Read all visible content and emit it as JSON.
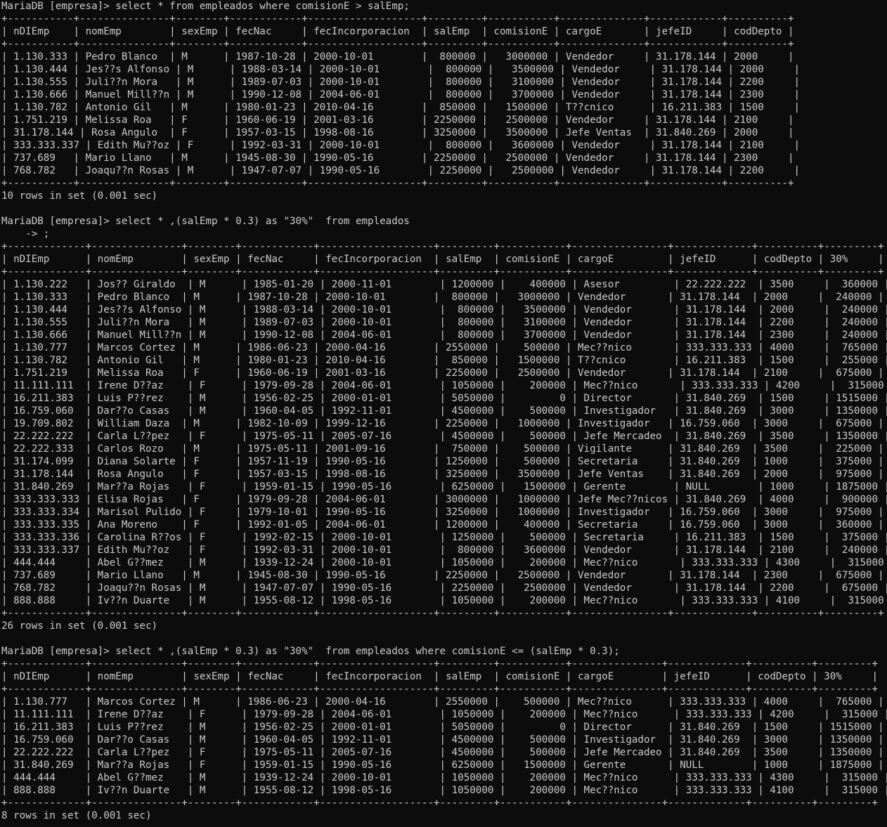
{
  "terminal": {
    "lines": [
      "MariaDB [empresa]> select * from empleados where comisionE > salEmp;",
      "+-----------+---------------+--------+------------+-------------------+---------+-----------+--------------+------------+----------+",
      "| nDIEmp    | nomEmp        | sexEmp | fecNac     | fecIncorporacion  | salEmp  | comisionE | cargoE       | jefeID     | codDepto |",
      "+-----------+---------------+--------+------------+-------------------+---------+-----------+--------------+------------+----------+",
      "| 1.130.333 | Pedro Blanco  | M      | 1987-10-28 | 2000-10-01        |  800000 |   3000000 | Vendedor     | 31.178.144 | 2000     |",
      "| 1.130.444 | Jes??s Alfonso | M      | 1988-03-14 | 2000-10-01        |  800000 |   3500000 | Vendedor     | 31.178.144 | 2000     |",
      "| 1.130.555 | Juli??n Mora   | M      | 1989-07-03 | 2000-10-01        |  800000 |   3100000 | Vendedor     | 31.178.144 | 2200     |",
      "| 1.130.666 | Manuel Mill??n | M      | 1990-12-08 | 2004-06-01        |  800000 |   3700000 | Vendedor     | 31.178.144 | 2300     |",
      "| 1.130.782 | Antonio Gil   | M      | 1980-01-23 | 2010-04-16        |  850000 |   1500000 | T??cnico      | 16.211.383 | 1500     |",
      "| 1.751.219 | Melissa Roa   | F      | 1960-06-19 | 2001-03-16        | 2250000 |   2500000 | Vendedor     | 31.178.144 | 2100     |",
      "| 31.178.144 | Rosa Angulo  | F      | 1957-03-15 | 1998-08-16        | 3250000 |   3500000 | Jefe Ventas  | 31.840.269 | 2000     |",
      "| 333.333.337 | Edith Mu??oz | F      | 1992-03-31 | 2000-10-01        |  800000 |   3600000 | Vendedor     | 31.178.144 | 2100     |",
      "| 737.689   | Mario Llano   | M      | 1945-08-30 | 1990-05-16        | 2250000 |   2500000 | Vendedor     | 31.178.144 | 2300     |",
      "| 768.782   | Joaqu??n Rosas | M      | 1947-07-07 | 1990-05-16        | 2250000 |   2500000 | Vendedor     | 31.178.144 | 2200     |",
      "+-----------+---------------+--------+------------+-------------------+---------+-----------+--------------+------------+----------+",
      "10 rows in set (0.001 sec)",
      "",
      "MariaDB [empresa]> select * ,(salEmp * 0.3) as \"30%\"  from empleados",
      "    -> ;",
      "+-------------+---------------+--------+------------+-------------------+---------+-----------+----------------+-------------+----------+---------+",
      "| nDIEmp      | nomEmp        | sexEmp | fecNac     | fecIncorporacion  | salEmp  | comisionE | cargoE         | jefeID      | codDepto | 30%     |",
      "+-------------+---------------+--------+------------+-------------------+---------+-----------+----------------+-------------+----------+---------+",
      "| 1.130.222   | Jos?? Giraldo  | M      | 1985-01-20 | 2000-11-01        | 1200000 |    400000 | Asesor         | 22.222.222  | 3500     |  360000 |",
      "| 1.130.333   | Pedro Blanco  | M      | 1987-10-28 | 2000-10-01        |  800000 |   3000000 | Vendedor       | 31.178.144  | 2000     |  240000 |",
      "| 1.130.444   | Jes??s Alfonso | M      | 1988-03-14 | 2000-10-01        |  800000 |   3500000 | Vendedor       | 31.178.144  | 2000     |  240000 |",
      "| 1.130.555   | Juli??n Mora   | M      | 1989-07-03 | 2000-10-01        |  800000 |   3100000 | Vendedor       | 31.178.144  | 2200     |  240000 |",
      "| 1.130.666   | Manuel Mill??n | M      | 1990-12-08 | 2004-06-01        |  800000 |   3700000 | Vendedor       | 31.178.144  | 2300     |  240000 |",
      "| 1.130.777   | Marcos Cortez | M      | 1986-06-23 | 2000-04-16        | 2550000 |    500000 | Mec??nico       | 333.333.333 | 4000     |  765000 |",
      "| 1.130.782   | Antonio Gil   | M      | 1980-01-23 | 2010-04-16        |  850000 |   1500000 | T??cnico        | 16.211.383  | 1500     |  255000 |",
      "| 1.751.219   | Melissa Roa   | F      | 1960-06-19 | 2001-03-16        | 2250000 |   2500000 | Vendedor       | 31.178.144  | 2100     |  675000 |",
      "| 11.111.111  | Irene D??az    | F      | 1979-09-28 | 2004-06-01        | 1050000 |    200000 | Mec??nico       | 333.333.333 | 4200     |  315000 |",
      "| 16.211.383  | Luis P??rez    | M      | 1956-02-25 | 2000-01-01        | 5050000 |         0 | Director       | 31.840.269  | 1500     | 1515000 |",
      "| 16.759.060  | Dar??o Casas   | M      | 1960-04-05 | 1992-11-01        | 4500000 |    500000 | Investigador   | 31.840.269  | 3000     | 1350000 |",
      "| 19.709.802  | William Daza  | M      | 1982-10-09 | 1999-12-16        | 2250000 |   1000000 | Investigador   | 16.759.060  | 3000     |  675000 |",
      "| 22.222.222  | Carla L??pez   | F      | 1975-05-11 | 2005-07-16        | 4500000 |    500000 | Jefe Mercadeo  | 31.840.269  | 3500     | 1350000 |",
      "| 22.222.333  | Carlos Rozo   | M      | 1975-05-11 | 2001-09-16        |  750000 |    500000 | Vigilante      | 31.840.269  | 3500     |  225000 |",
      "| 31.174.099  | Diana Solarte | F      | 1957-11-19 | 1990-05-16        | 1250000 |    500000 | Secretaria     | 31.840.269  | 1000     |  375000 |",
      "| 31.178.144  | Rosa Angulo   | F      | 1957-03-15 | 1998-08-16        | 3250000 |   3500000 | Jefe Ventas    | 31.840.269  | 2000     |  975000 |",
      "| 31.840.269  | Mar??a Rojas   | F      | 1959-01-15 | 1990-05-16        | 6250000 |   1500000 | Gerente        | NULL        | 1000     | 1875000 |",
      "| 333.333.333 | Elisa Rojas   | F      | 1979-09-28 | 2004-06-01        | 3000000 |   1000000 | Jefe Mec??nicos | 31.840.269  | 4000     |  900000 |",
      "| 333.333.334 | Marisol Pulido | F     | 1979-10-01 | 1990-05-16        | 3250000 |   1000000 | Investigador   | 16.759.060  | 3000     |  975000 |",
      "| 333.333.335 | Ana Moreno    | F      | 1992-01-05 | 2004-06-01        | 1200000 |    400000 | Secretaria     | 16.759.060  | 3000     |  360000 |",
      "| 333.333.336 | Carolina R??os | F      | 1992-02-15 | 2000-10-01        | 1250000 |    500000 | Secretaria     | 16.211.383  | 1500     |  375000 |",
      "| 333.333.337 | Edith Mu??oz   | F      | 1992-03-31 | 2000-10-01        |  800000 |   3600000 | Vendedor       | 31.178.144  | 2100     |  240000 |",
      "| 444.444     | Abel G??mez    | M      | 1939-12-24 | 2000-10-01        | 1050000 |    200000 | Mec??nico       | 333.333.333 | 4300     |  315000 |",
      "| 737.689     | Mario Llano   | M      | 1945-08-30 | 1990-05-16        | 2250000 |   2500000 | Vendedor       | 31.178.144  | 2300     |  675000 |",
      "| 768.782     | Joaqu??n Rosas | M      | 1947-07-07 | 1990-05-16        | 2250000 |   2500000 | Vendedor       | 31.178.144  | 2200     |  675000 |",
      "| 888.888     | Iv??n Duarte   | M      | 1955-08-12 | 1998-05-16        | 1050000 |    200000 | Mec??nico       | 333.333.333 | 4100     |  315000 |",
      "+-------------+---------------+--------+------------+-------------------+---------+-----------+----------------+-------------+----------+---------+",
      "26 rows in set (0.001 sec)",
      "",
      "MariaDB [empresa]> select * ,(salEmp * 0.3) as \"30%\"  from empleados where comisionE <= (salEmp * 0.3);",
      "+-------------+---------------+--------+------------+-------------------+---------+-----------+---------------+-------------+----------+---------+",
      "| nDIEmp      | nomEmp        | sexEmp | fecNac     | fecIncorporacion  | salEmp  | comisionE | cargoE        | jefeID      | codDepto | 30%     |",
      "+-------------+---------------+--------+------------+-------------------+---------+-----------+---------------+-------------+----------+---------+",
      "| 1.130.777   | Marcos Cortez | M      | 1986-06-23 | 2000-04-16        | 2550000 |    500000 | Mec??nico      | 333.333.333 | 4000     |  765000 |",
      "| 11.111.111  | Irene D??az    | F      | 1979-09-28 | 2004-06-01        | 1050000 |    200000 | Mec??nico      | 333.333.333 | 4200     |  315000 |",
      "| 16.211.383  | Luis P??rez    | M      | 1956-02-25 | 2000-01-01        | 5050000 |         0 | Director      | 31.840.269  | 1500     | 1515000 |",
      "| 16.759.060  | Dar??o Casas   | M      | 1960-04-05 | 1992-11-01        | 4500000 |    500000 | Investigador  | 31.840.269  | 3000     | 1350000 |",
      "| 22.222.222  | Carla L??pez   | F      | 1975-05-11 | 2005-07-16        | 4500000 |    500000 | Jefe Mercadeo | 31.840.269  | 3500     | 1350000 |",
      "| 31.840.269  | Mar??a Rojas   | F      | 1959-01-15 | 1990-05-16        | 6250000 |   1500000 | Gerente       | NULL        | 1000     | 1875000 |",
      "| 444.444     | Abel G??mez    | M      | 1939-12-24 | 2000-10-01        | 1050000 |    200000 | Mec??nico      | 333.333.333 | 4300     |  315000 |",
      "| 888.888     | Iv??n Duarte   | M      | 1955-08-12 | 1998-05-16        | 1050000 |    200000 | Mec??nico      | 333.333.333 | 4100     |  315000 |",
      "+-------------+---------------+--------+------------+-------------------+---------+-----------+---------------+-------------+----------+---------+",
      "8 rows in set (0.001 sec)"
    ]
  }
}
